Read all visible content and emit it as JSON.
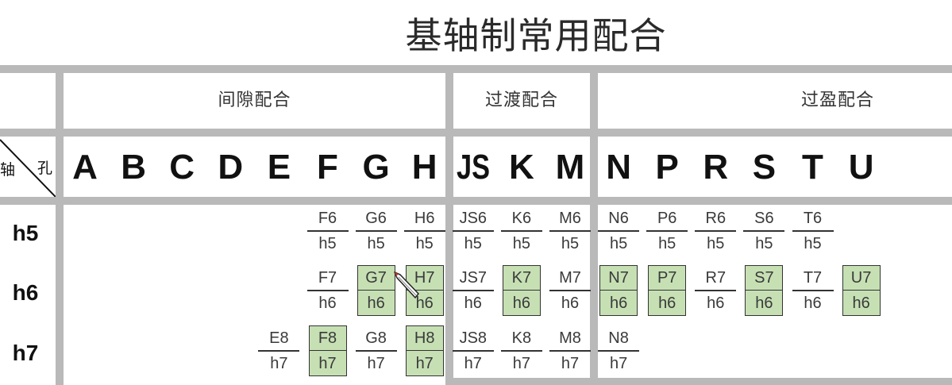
{
  "title": "基轴制常用配合",
  "groups": [
    {
      "label": "间隙配合"
    },
    {
      "label": "过渡配合"
    },
    {
      "label": "过盈配合"
    }
  ],
  "corner": {
    "shaft": "轴",
    "hole": "孔"
  },
  "columns": [
    "A",
    "B",
    "C",
    "D",
    "E",
    "F",
    "G",
    "H",
    "JS",
    "K",
    "M",
    "N",
    "P",
    "R",
    "S",
    "T",
    "U"
  ],
  "rows": [
    {
      "label": "h5",
      "cells": [
        null,
        null,
        null,
        null,
        null,
        {
          "hole": "F6",
          "shaft": "h5",
          "highlighted": false
        },
        {
          "hole": "G6",
          "shaft": "h5",
          "highlighted": false
        },
        {
          "hole": "H6",
          "shaft": "h5",
          "highlighted": false
        },
        {
          "hole": "JS6",
          "shaft": "h5",
          "highlighted": false
        },
        {
          "hole": "K6",
          "shaft": "h5",
          "highlighted": false
        },
        {
          "hole": "M6",
          "shaft": "h5",
          "highlighted": false
        },
        {
          "hole": "N6",
          "shaft": "h5",
          "highlighted": false
        },
        {
          "hole": "P6",
          "shaft": "h5",
          "highlighted": false
        },
        {
          "hole": "R6",
          "shaft": "h5",
          "highlighted": false
        },
        {
          "hole": "S6",
          "shaft": "h5",
          "highlighted": false
        },
        {
          "hole": "T6",
          "shaft": "h5",
          "highlighted": false
        },
        null
      ]
    },
    {
      "label": "h6",
      "cells": [
        null,
        null,
        null,
        null,
        null,
        {
          "hole": "F7",
          "shaft": "h6",
          "highlighted": false
        },
        {
          "hole": "G7",
          "shaft": "h6",
          "highlighted": true
        },
        {
          "hole": "H7",
          "shaft": "h6",
          "highlighted": true
        },
        {
          "hole": "JS7",
          "shaft": "h6",
          "highlighted": false
        },
        {
          "hole": "K7",
          "shaft": "h6",
          "highlighted": true
        },
        {
          "hole": "M7",
          "shaft": "h6",
          "highlighted": false
        },
        {
          "hole": "N7",
          "shaft": "h6",
          "highlighted": true
        },
        {
          "hole": "P7",
          "shaft": "h6",
          "highlighted": true
        },
        {
          "hole": "R7",
          "shaft": "h6",
          "highlighted": false
        },
        {
          "hole": "S7",
          "shaft": "h6",
          "highlighted": true
        },
        {
          "hole": "T7",
          "shaft": "h6",
          "highlighted": false
        },
        {
          "hole": "U7",
          "shaft": "h6",
          "highlighted": true
        }
      ]
    },
    {
      "label": "h7",
      "cells": [
        null,
        null,
        null,
        null,
        {
          "hole": "E8",
          "shaft": "h7",
          "highlighted": false
        },
        {
          "hole": "F8",
          "shaft": "h7",
          "highlighted": true
        },
        {
          "hole": "G8",
          "shaft": "h7",
          "highlighted": false
        },
        {
          "hole": "H8",
          "shaft": "h7",
          "highlighted": true
        },
        {
          "hole": "JS8",
          "shaft": "h7",
          "highlighted": false
        },
        {
          "hole": "K8",
          "shaft": "h7",
          "highlighted": false
        },
        {
          "hole": "M8",
          "shaft": "h7",
          "highlighted": false
        },
        {
          "hole": "N8",
          "shaft": "h7",
          "highlighted": false
        },
        null,
        null,
        null,
        null,
        null
      ]
    }
  ],
  "colors": {
    "grid": "#b9b9b9",
    "highlight_fill": "#c6e0b4",
    "border": "#333333",
    "text": "#333333"
  },
  "icons": {
    "cursor": "pen-cursor-icon"
  }
}
